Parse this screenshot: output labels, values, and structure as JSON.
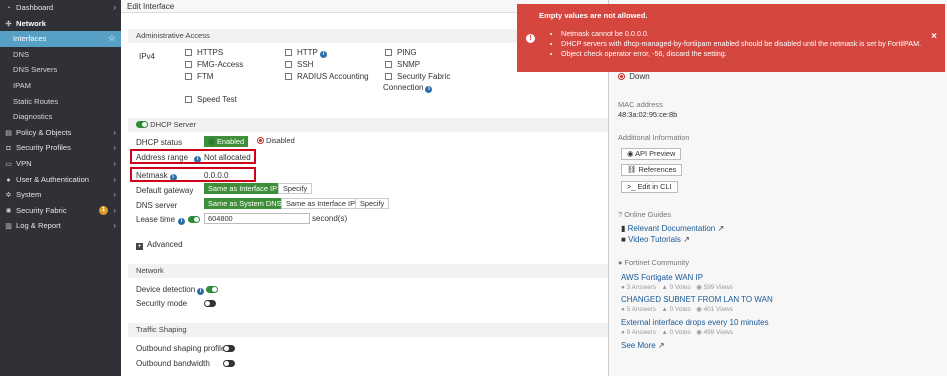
{
  "sidebar": {
    "items": [
      {
        "label": "Dashboard",
        "icon": "dashboard-icon",
        "glyph": "◔",
        "level": "top",
        "chevron": true
      },
      {
        "label": "Network",
        "icon": "network-icon",
        "glyph": "✣",
        "level": "top",
        "expanded": true
      },
      {
        "label": "Interfaces",
        "level": "sub",
        "active": true
      },
      {
        "label": "DNS",
        "level": "sub"
      },
      {
        "label": "DNS Servers",
        "level": "sub"
      },
      {
        "label": "IPAM",
        "level": "sub"
      },
      {
        "label": "Static Routes",
        "level": "sub"
      },
      {
        "label": "Diagnostics",
        "level": "sub"
      },
      {
        "label": "Policy & Objects",
        "icon": "policy-icon",
        "glyph": "▤",
        "level": "top",
        "chevron": true
      },
      {
        "label": "Security Profiles",
        "icon": "lock-icon",
        "glyph": "◘",
        "level": "top",
        "chevron": true
      },
      {
        "label": "VPN",
        "icon": "vpn-icon",
        "glyph": "▭",
        "level": "top",
        "chevron": true
      },
      {
        "label": "User & Authentication",
        "icon": "user-icon",
        "glyph": "●",
        "level": "top",
        "chevron": true
      },
      {
        "label": "System",
        "icon": "gear-icon",
        "glyph": "✲",
        "level": "top",
        "chevron": true
      },
      {
        "label": "Security Fabric",
        "icon": "fabric-icon",
        "glyph": "✺",
        "level": "top",
        "chevron": true,
        "badge": "1"
      },
      {
        "label": "Log & Report",
        "icon": "chart-icon",
        "glyph": "▥",
        "level": "top",
        "chevron": true
      }
    ]
  },
  "main": {
    "title": "Edit Interface",
    "admin_access": {
      "heading": "Administrative Access",
      "ipv4_label": "IPv4",
      "col1": [
        "HTTPS",
        "FMG-Access",
        "FTM",
        "Speed Test"
      ],
      "col2": [
        "HTTP",
        "SSH",
        "RADIUS Accounting"
      ],
      "col3": [
        "PING",
        "SNMP",
        "Security Fabric",
        "Connection"
      ]
    },
    "dhcp": {
      "heading": "DHCP Server",
      "status_label": "DHCP status",
      "enabled": "Enabled",
      "disabled": "Disabled",
      "address_range_label": "Address range",
      "address_range_value": "Not allocated",
      "netmask_label": "Netmask",
      "netmask_value": "0.0.0.0",
      "gateway_label": "Default gateway",
      "gateway_opt1": "Same as Interface IP",
      "gateway_opt2": "Specify",
      "dns_label": "DNS server",
      "dns_opt1": "Same as System DNS",
      "dns_opt2": "Same as Interface IP",
      "dns_opt3": "Specify",
      "lease_label": "Lease time",
      "lease_value": "604800",
      "lease_unit": "second(s)",
      "advanced": "Advanced"
    },
    "network": {
      "heading": "Network",
      "device_detection": "Device detection",
      "security_mode": "Security mode"
    },
    "traffic": {
      "heading": "Traffic Shaping",
      "outbound_profile": "Outbound shaping profile",
      "outbound_bandwidth": "Outbound bandwidth"
    }
  },
  "right": {
    "status": "Down",
    "mac_label": "MAC address",
    "mac_value": "48:3a:02:95:ce:8b",
    "additional_heading": "Additional Information",
    "api_preview": "API Preview",
    "references": "References",
    "edit_cli": "Edit in CLI",
    "guides_heading": "Online Guides",
    "relevant_docs": "Relevant Documentation",
    "video_tutorials": "Video Tutorials",
    "community_heading": "Fortinet Community",
    "posts": [
      {
        "title": "AWS Fortigate WAN IP",
        "answers": "3 Answers",
        "votes": "0 Votes",
        "views": "599 Views"
      },
      {
        "title": "CHANGED SUBNET FROM LAN TO WAN",
        "answers": "5 Answers",
        "votes": "0 Votes",
        "views": "401 Views"
      },
      {
        "title": "External interface drops every 10 minutes",
        "answers": "9 Answers",
        "votes": "0 Votes",
        "views": "499 Views"
      }
    ],
    "see_more": "See More"
  },
  "toast": {
    "title": "Empty values are not allowed.",
    "messages": [
      "Netmask cannot be 0.0.0.0.",
      "DHCP servers with dhcp-managed-by-fortiipam enabled should be disabled until the netmask is set by FortiIPAM.",
      "Object check operator error, -56, discard the setting."
    ],
    "close": "×"
  },
  "colors": {
    "sidebar_bg": "#2f3136",
    "active_nav": "#56a0c6",
    "enabled_green": "#3f8f3a",
    "toast_red": "#d4463e",
    "highlight_red": "#d0021b",
    "link_blue": "#1a5a96"
  }
}
